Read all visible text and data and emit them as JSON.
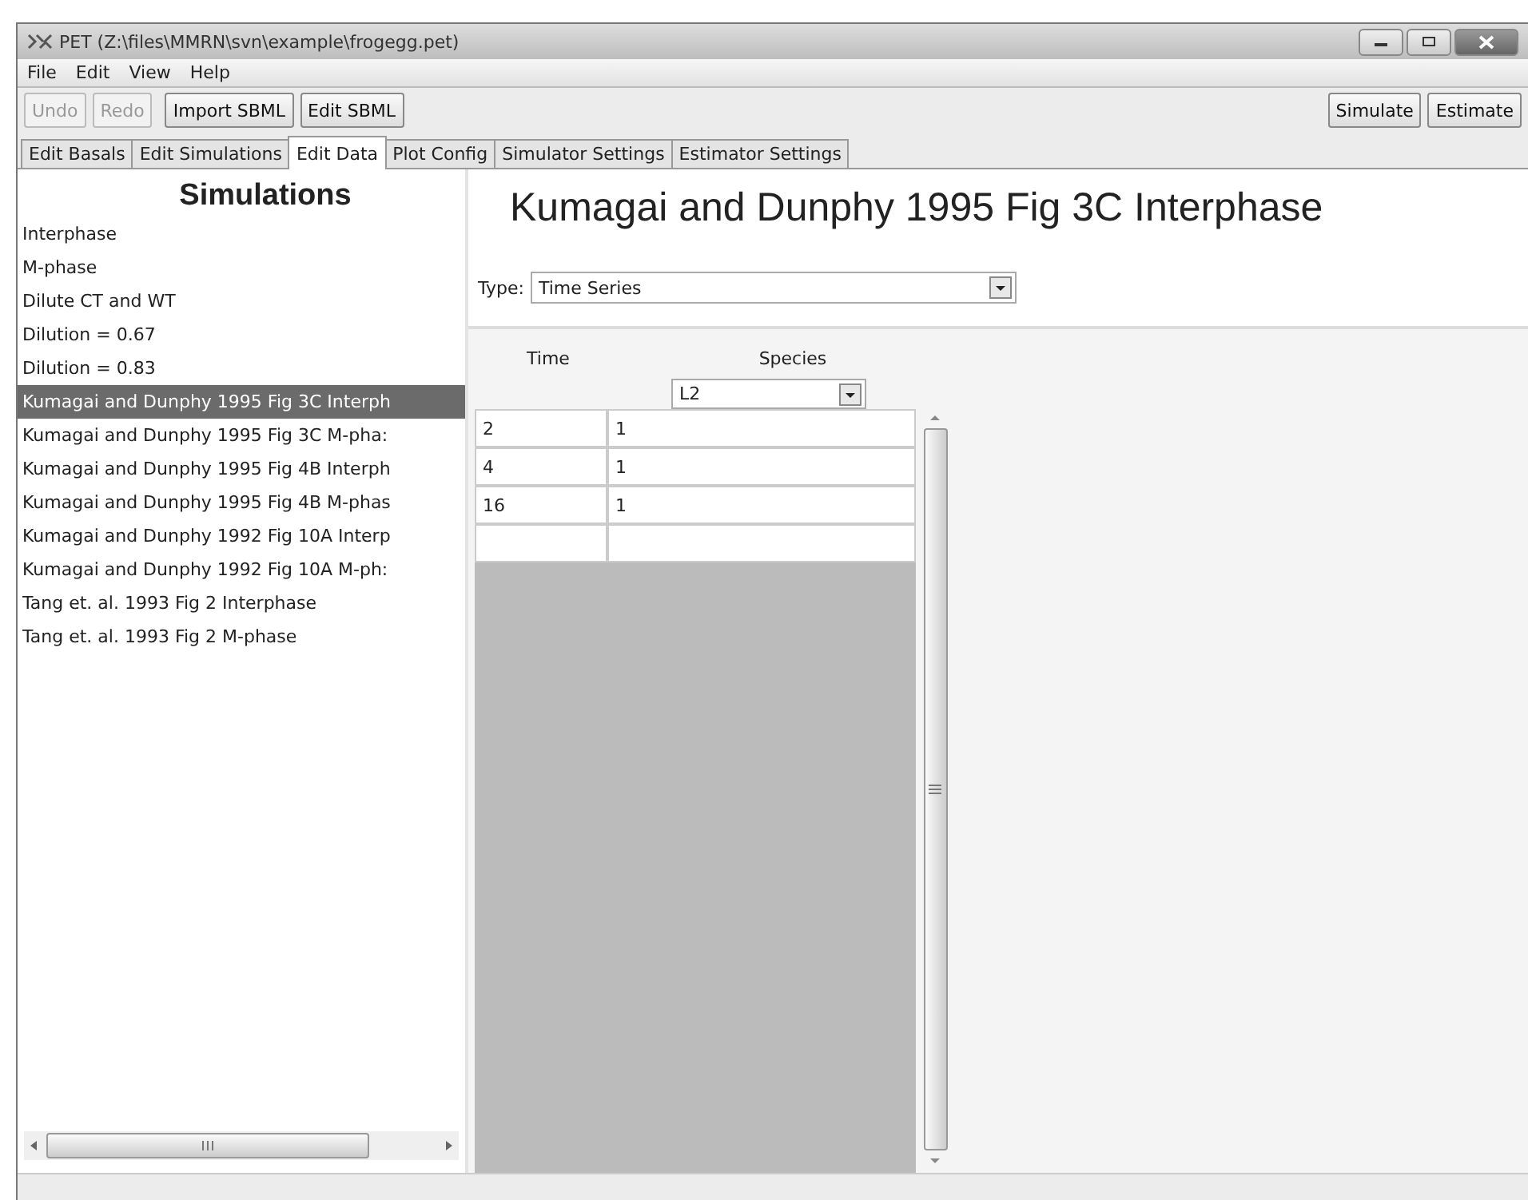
{
  "window": {
    "title": "PET (Z:\\files\\MMRN\\svn\\example\\frogegg.pet)"
  },
  "menu": [
    "File",
    "Edit",
    "View",
    "Help"
  ],
  "toolbar": {
    "left": [
      {
        "label": "Undo",
        "disabled": true
      },
      {
        "label": "Redo",
        "disabled": true
      },
      {
        "label": "Import SBML",
        "disabled": false
      },
      {
        "label": "Edit SBML",
        "disabled": false
      }
    ],
    "right": [
      {
        "label": "Simulate",
        "disabled": false
      },
      {
        "label": "Estimate",
        "disabled": false
      }
    ]
  },
  "tabs": [
    {
      "label": "Edit Basals",
      "selected": false
    },
    {
      "label": "Edit Simulations",
      "selected": false
    },
    {
      "label": "Edit Data",
      "selected": true
    },
    {
      "label": "Plot Config",
      "selected": false
    },
    {
      "label": "Simulator Settings",
      "selected": false
    },
    {
      "label": "Estimator Settings",
      "selected": false
    }
  ],
  "sidebar": {
    "title": "Simulations",
    "items": [
      {
        "label": "Interphase",
        "selected": false
      },
      {
        "label": "M-phase",
        "selected": false
      },
      {
        "label": "Dilute CT and WT",
        "selected": false
      },
      {
        "label": "Dilution = 0.67",
        "selected": false
      },
      {
        "label": "Dilution = 0.83",
        "selected": false
      },
      {
        "label": "Kumagai and Dunphy 1995 Fig 3C Interph",
        "selected": true
      },
      {
        "label": "Kumagai and Dunphy 1995 Fig 3C M-pha:",
        "selected": false
      },
      {
        "label": "Kumagai and Dunphy 1995 Fig 4B Interph",
        "selected": false
      },
      {
        "label": "Kumagai and Dunphy 1995 Fig 4B M-phas",
        "selected": false
      },
      {
        "label": "Kumagai and Dunphy 1992 Fig 10A Interp",
        "selected": false
      },
      {
        "label": "Kumagai and Dunphy 1992 Fig 10A M-ph:",
        "selected": false
      },
      {
        "label": "Tang et. al. 1993 Fig 2 Interphase",
        "selected": false
      },
      {
        "label": "Tang et. al. 1993 Fig 2 M-phase",
        "selected": false
      }
    ]
  },
  "editor": {
    "title": "Kumagai and Dunphy 1995 Fig 3C Interphase",
    "type_label": "Type:",
    "type_value": "Time Series",
    "table": {
      "columns": [
        "Time",
        "Species"
      ],
      "species_value": "L2",
      "rows": [
        [
          "2",
          "1"
        ],
        [
          "4",
          "1"
        ],
        [
          "16",
          "1"
        ],
        [
          "",
          ""
        ]
      ]
    }
  }
}
